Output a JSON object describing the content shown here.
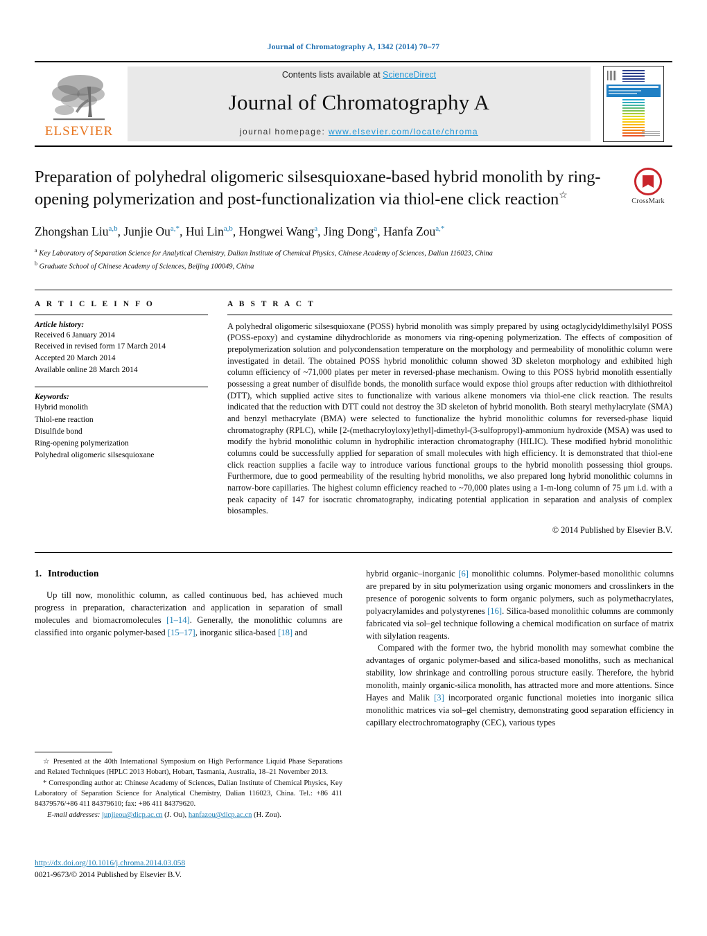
{
  "running_head": "Journal of Chromatography A, 1342 (2014) 70–77",
  "masthead": {
    "contents_prefix": "Contents lists available at ",
    "sciencedirect": "ScienceDirect",
    "journal_title": "Journal of Chromatography A",
    "homepage_prefix": "journal homepage: ",
    "homepage_url": "www.elsevier.com/locate/chroma",
    "publisher": "ELSEVIER",
    "accent_blue": "#2196d6",
    "elsevier_orange": "#e87722"
  },
  "article": {
    "title": "Preparation of polyhedral oligomeric silsesquioxane-based hybrid monolith by ring-opening polymerization and post-functionalization via thiol-ene click reaction",
    "title_footnote_mark": "☆",
    "authors": "Zhongshan Liu a,b, Junjie Ou a,*, Hui Lin a,b, Hongwei Wang a, Jing Dong a, Hanfa Zou a,*",
    "affiliation_a": "Key Laboratory of Separation Science for Analytical Chemistry, Dalian Institute of Chemical Physics, Chinese Academy of Sciences, Dalian 116023, China",
    "affiliation_b": "Graduate School of Chinese Academy of Sciences, Beijing 100049, China",
    "crossmark_label": "CrossMark"
  },
  "article_info": {
    "heading": "A R T I C L E    I N F O",
    "history_label": "Article history:",
    "history": [
      "Received 6 January 2014",
      "Received in revised form 17 March 2014",
      "Accepted 20 March 2014",
      "Available online 28 March 2014"
    ],
    "keywords_label": "Keywords:",
    "keywords": [
      "Hybrid monolith",
      "Thiol-ene reaction",
      "Disulfide bond",
      "Ring-opening polymerization",
      "Polyhedral oligomeric silsesquioxane"
    ]
  },
  "abstract": {
    "heading": "A B S T R A C T",
    "text": "A polyhedral oligomeric silsesquioxane (POSS) hybrid monolith was simply prepared by using octaglycidyldimethylsilyl POSS (POSS-epoxy) and cystamine dihydrochloride as monomers via ring-opening polymerization. The effects of composition of prepolymerization solution and polycondensation temperature on the morphology and permeability of monolithic column were investigated in detail. The obtained POSS hybrid monolithic column showed 3D skeleton morphology and exhibited high column efficiency of ~71,000 plates per meter in reversed-phase mechanism. Owing to this POSS hybrid monolith essentially possessing a great number of disulfide bonds, the monolith surface would expose thiol groups after reduction with dithiothreitol (DTT), which supplied active sites to functionalize with various alkene monomers via thiol-ene click reaction. The results indicated that the reduction with DTT could not destroy the 3D skeleton of hybrid monolith. Both stearyl methylacrylate (SMA) and benzyl methacrylate (BMA) were selected to functionalize the hybrid monolithic columns for reversed-phase liquid chromatography (RPLC), while [2-(methacryloyloxy)ethyl]-dimethyl-(3-sulfopropyl)-ammonium hydroxide (MSA) was used to modify the hybrid monolithic column in hydrophilic interaction chromatography (HILIC). These modified hybrid monolithic columns could be successfully applied for separation of small molecules with high efficiency. It is demonstrated that thiol-ene click reaction supplies a facile way to introduce various functional groups to the hybrid monolith possessing thiol groups. Furthermore, due to good permeability of the resulting hybrid monoliths, we also prepared long hybrid monolithic columns in narrow-bore capillaries. The highest column efficiency reached to ~70,000 plates using a 1-m-long column of 75 μm i.d. with a peak capacity of 147 for isocratic chromatography, indicating potential application in separation and analysis of complex biosamples.",
    "copyright": "© 2014 Published by Elsevier B.V."
  },
  "introduction": {
    "number": "1.",
    "heading": "Introduction",
    "paragraph_left_1_a": "Up till now, monolithic column, as called continuous bed, has achieved much progress in preparation, characterization and application in separation of small molecules and biomacromolecules ",
    "ref_1_14": "[1–14]",
    "paragraph_left_1_b": ". Generally, the monolithic columns are classified into organic polymer-based ",
    "ref_15_17": "[15–17]",
    "paragraph_left_1_c": ", inorganic silica-based ",
    "ref_18": "[18]",
    "paragraph_left_1_d": " and ",
    "paragraph_right_1_a": "hybrid organic–inorganic ",
    "ref_6": "[6]",
    "paragraph_right_1_b": " monolithic columns. Polymer-based monolithic columns are prepared by in situ polymerization using organic monomers and crosslinkers in the presence of porogenic solvents to form organic polymers, such as polymethacrylates, polyacrylamides and polystyrenes ",
    "ref_16": "[16]",
    "paragraph_right_1_c": ". Silica-based monolithic columns are commonly fabricated via sol–gel technique following a chemical modification on surface of matrix with silylation reagents.",
    "paragraph_right_2_a": "Compared with the former two, the hybrid monolith may somewhat combine the advantages of organic polymer-based and silica-based monoliths, such as mechanical stability, low shrinkage and controlling porous structure easily. Therefore, the hybrid monolith, mainly organic-silica monolith, has attracted more and more attentions. Since Hayes and Malik ",
    "ref_3": "[3]",
    "paragraph_right_2_b": " incorporated organic functional moieties into inorganic silica monolithic matrices via sol–gel chemistry, demonstrating good separation efficiency in capillary electrochromatography (CEC), various types"
  },
  "footnotes": {
    "star_mark": "☆",
    "presented_note": " Presented at the 40th International Symposium on High Performance Liquid Phase Separations and Related Techniques (HPLC 2013 Hobart), Hobart, Tasmania, Australia, 18–21 November 2013.",
    "corresponding_mark": "*",
    "corresponding_note": " Corresponding author at: Chinese Academy of Sciences, Dalian Institute of Chemical Physics, Key Laboratory of Separation Science for Analytical Chemistry, Dalian 116023, China. Tel.: +86 411 84379576/+86 411 84379610; fax: +86 411 84379620.",
    "email_label": "E-mail addresses:",
    "email_1": "junjieou@dicp.ac.cn",
    "email_1_owner": " (J. Ou), ",
    "email_2": "hanfazou@dicp.ac.cn",
    "email_2_owner": " (H. Zou)."
  },
  "doi_block": {
    "doi_url": "http://dx.doi.org/10.1016/j.chroma.2014.03.058",
    "issn_line": "0021-9673/© 2014 Published by Elsevier B.V."
  }
}
